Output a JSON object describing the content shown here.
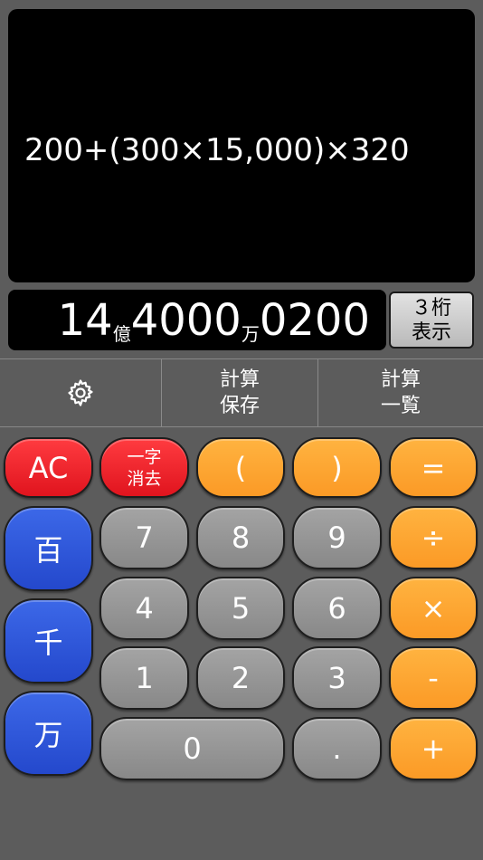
{
  "display": {
    "expression": "200+(300×15,000)×320",
    "result": {
      "part1": "14",
      "unit1": "億",
      "part2": "4000",
      "unit2": "万",
      "part3": "0200"
    }
  },
  "digits_toggle": {
    "line1": "３桁",
    "line2": "表示"
  },
  "toolbar": {
    "settings_icon": "gear-icon",
    "save_line1": "計算",
    "save_line2": "保存",
    "list_line1": "計算",
    "list_line2": "一覧"
  },
  "keys": {
    "ac": "AC",
    "delete_line1": "一字",
    "delete_line2": "消去",
    "open_paren": "(",
    "close_paren": ")",
    "equals": "=",
    "seven": "7",
    "eight": "8",
    "nine": "9",
    "divide": "÷",
    "hundred": "百",
    "four": "4",
    "five": "5",
    "six": "6",
    "multiply": "×",
    "thousand": "千",
    "one": "1",
    "two": "2",
    "three": "3",
    "minus": "-",
    "ten_thousand": "万",
    "zero": "0",
    "dot": ".",
    "plus": "+"
  },
  "colors": {
    "red": "#e91b22",
    "orange": "#fca32f",
    "gray": "#959595",
    "blue": "#2f55d8",
    "background": "#5c5c5c"
  }
}
